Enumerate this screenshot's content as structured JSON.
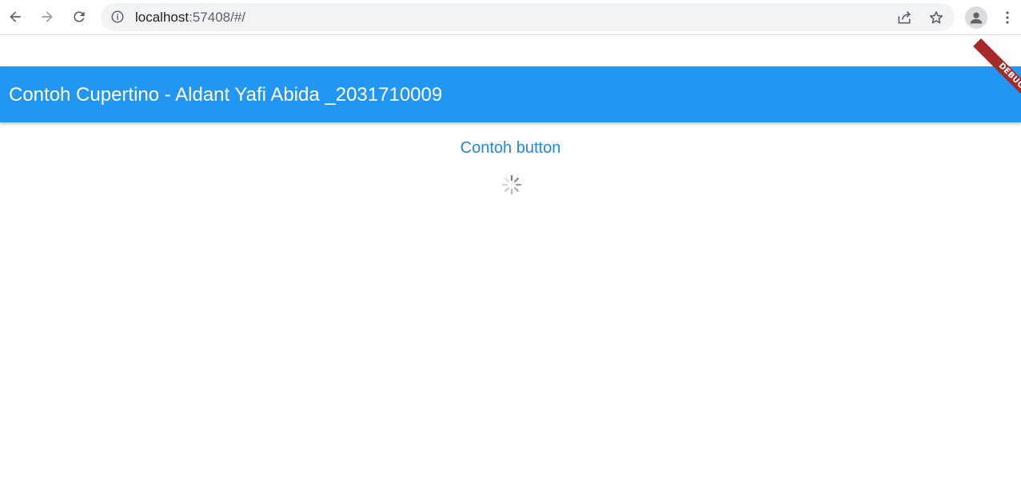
{
  "browser": {
    "url_host": "localhost",
    "url_rest": ":57408/#/",
    "icons": {
      "back": "arrow-left-icon",
      "forward": "arrow-right-icon",
      "reload": "reload-icon",
      "info": "info-icon",
      "share": "share-icon",
      "bookmark": "star-icon",
      "profile": "person-icon",
      "menu": "more-vert-icon"
    }
  },
  "app": {
    "title": "Contoh Cupertino - Aldant Yafi Abida _2031710009",
    "debug_label": "DEBUG",
    "button_label": "Contoh button",
    "colors": {
      "app_bar": "#2196f3",
      "button_text": "#1e88e5",
      "debug_banner": "#a52a2a"
    }
  }
}
